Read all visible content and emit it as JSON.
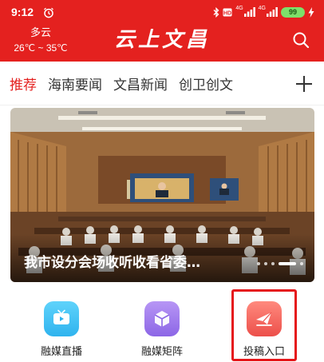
{
  "status_bar": {
    "time": "9:12",
    "network_label": "4G",
    "battery": "99",
    "icons": [
      "alarm-icon",
      "bluetooth-icon",
      "hd-icon",
      "signal-icon",
      "battery-icon",
      "charging-icon"
    ]
  },
  "header": {
    "weather_condition": "多云",
    "weather_temp": "26℃ ~ 35℃",
    "logo_text": "云上文昌",
    "background_color": "#e4211f"
  },
  "tabs": {
    "items": [
      {
        "label": "推荐",
        "active": true
      },
      {
        "label": "海南要闻",
        "active": false
      },
      {
        "label": "文昌新闻",
        "active": false
      },
      {
        "label": "创卫创文",
        "active": false
      }
    ],
    "active_color": "#e4211f"
  },
  "banner": {
    "caption": "我市设分会场收听收看省委…",
    "slide_count": 5,
    "active_slide": 4
  },
  "shortcuts": [
    {
      "label": "融媒直播",
      "icon": "tv-icon",
      "color": "#3fc1f5"
    },
    {
      "label": "融媒矩阵",
      "icon": "cube-icon",
      "color": "#9b78ee"
    },
    {
      "label": "投稿入口",
      "icon": "paper-plane-icon",
      "color": "#f06157"
    }
  ]
}
